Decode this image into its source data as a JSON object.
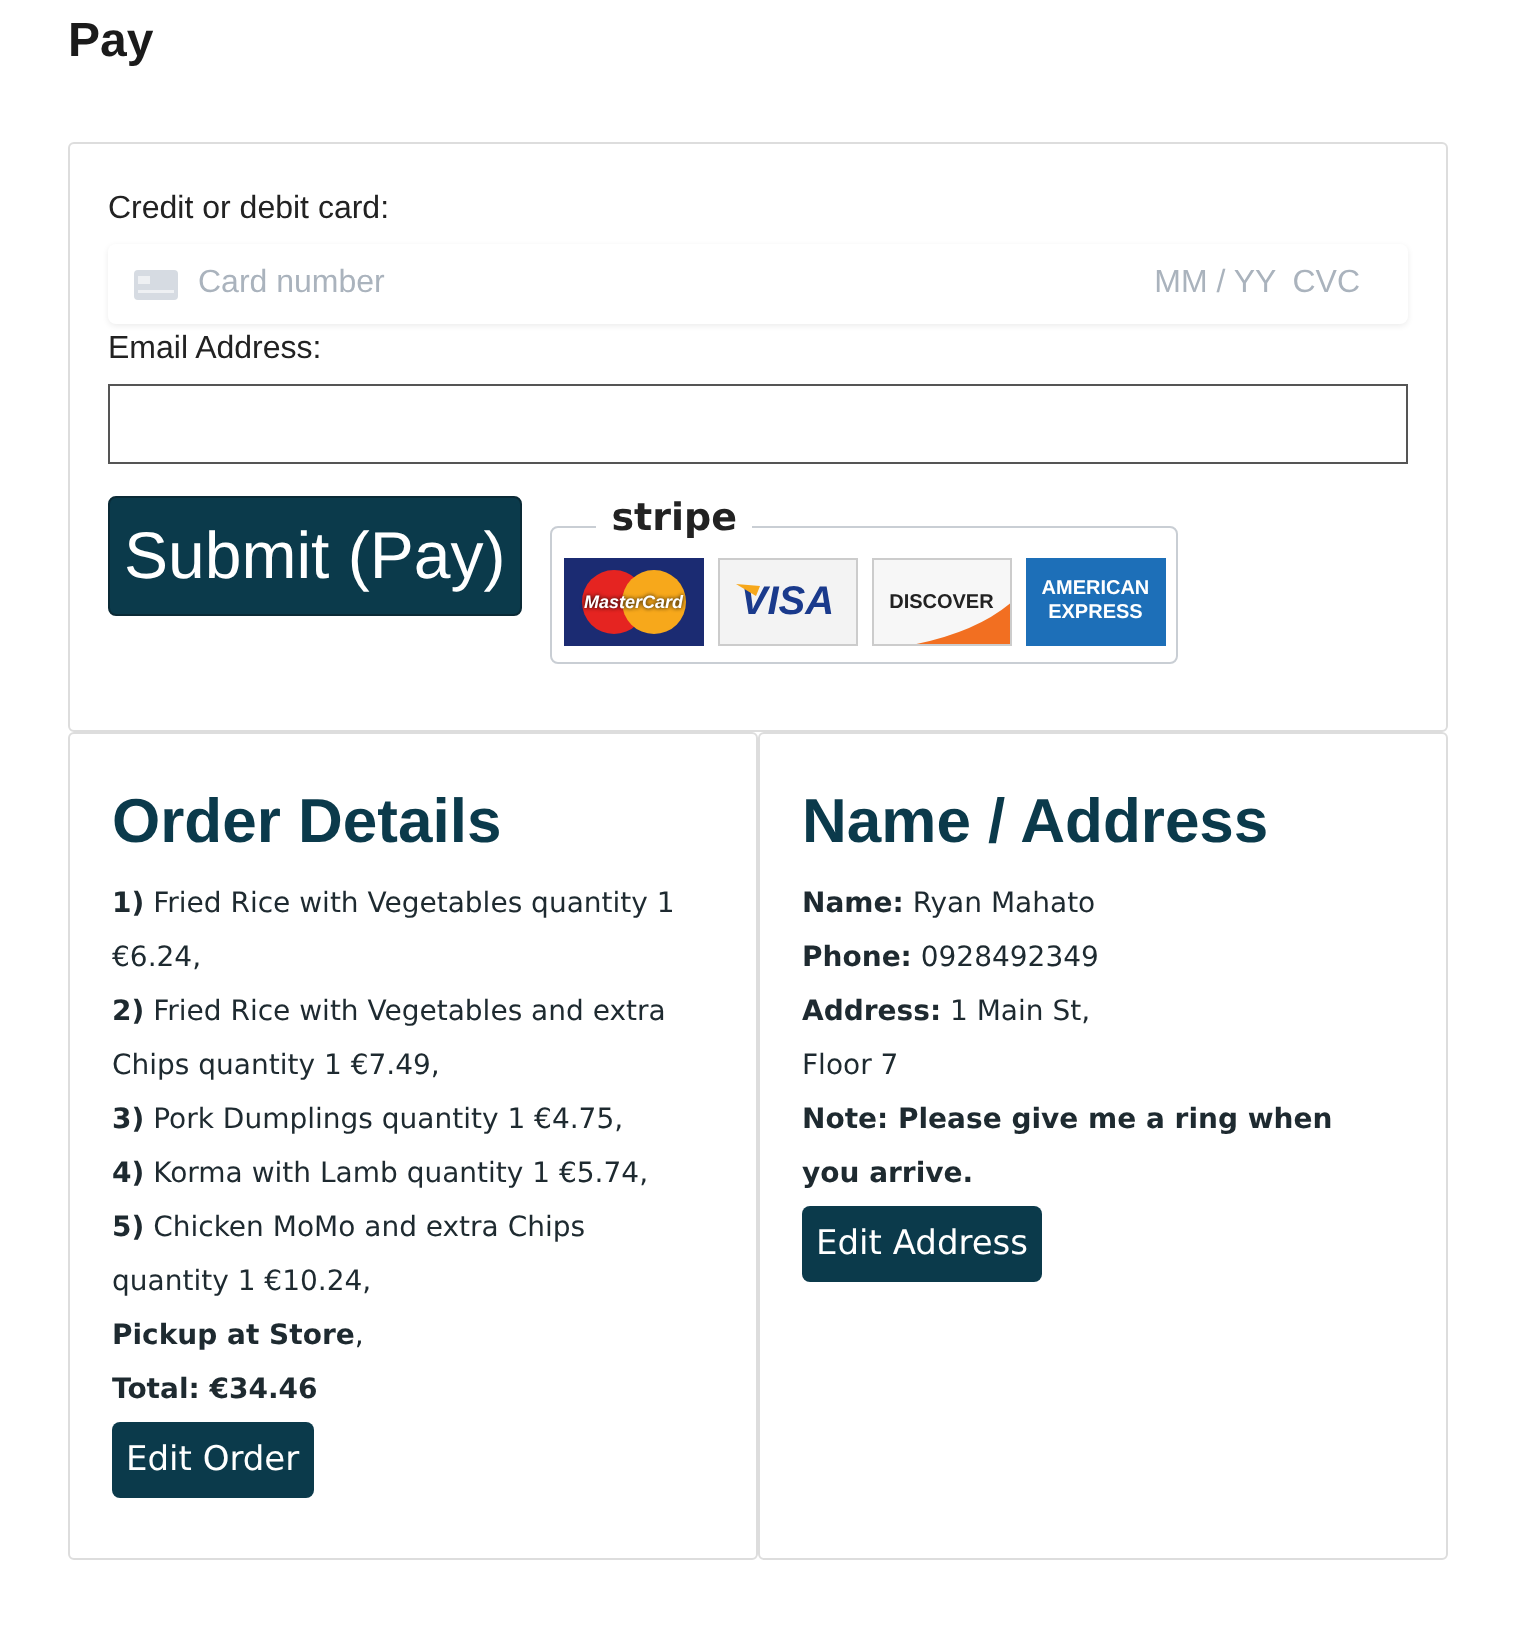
{
  "title": "Pay",
  "payment": {
    "card_label": "Credit or debit card:",
    "card_placeholder": "Card number",
    "expiry_placeholder": "MM / YY",
    "cvc_placeholder": "CVC",
    "email_label": "Email Address:",
    "submit": "Submit (Pay)",
    "badge": {
      "brand": "stripe",
      "cards": [
        {
          "kind": "mastercard",
          "label": "MasterCard"
        },
        {
          "kind": "visa",
          "label": "VISA"
        },
        {
          "kind": "discover",
          "label": "DISCOVER"
        },
        {
          "kind": "amex",
          "label": "AMERICAN EXPRESS"
        }
      ]
    }
  },
  "order": {
    "heading": "Order Details",
    "lines": [
      {
        "kind": "item",
        "text": "**1)** Fried Rice with Vegetables quantity 1 €6.24,"
      },
      {
        "kind": "item",
        "text": "**2)** Fried Rice with Vegetables and extra Chips quantity 1 €7.49,"
      },
      {
        "kind": "item",
        "text": "**3)** Pork Dumplings quantity 1 €4.75,"
      },
      {
        "kind": "item",
        "text": "**4)** Korma with Lamb quantity 1 €5.74,"
      },
      {
        "kind": "item",
        "text": "**5)** Chicken MoMo and extra Chips quantity 1 €10.24,"
      },
      {
        "kind": "item",
        "text": "**Pickup at Store**,"
      },
      {
        "kind": "total",
        "text": "Total: €34.46"
      }
    ],
    "button": "Edit Order"
  },
  "address": {
    "heading": "Name / Address",
    "lines": [
      {
        "kind": "field",
        "label": "Name:",
        "value": "Ryan Mahato"
      },
      {
        "kind": "field",
        "label": "Phone:",
        "value": "0928492349"
      },
      {
        "kind": "field",
        "label": "Address:",
        "value": "1 Main St,"
      },
      {
        "kind": "plain",
        "value": "Floor 7"
      },
      {
        "kind": "note",
        "value": "Note: Please give me a ring when you arrive."
      }
    ],
    "button": "Edit Address"
  }
}
